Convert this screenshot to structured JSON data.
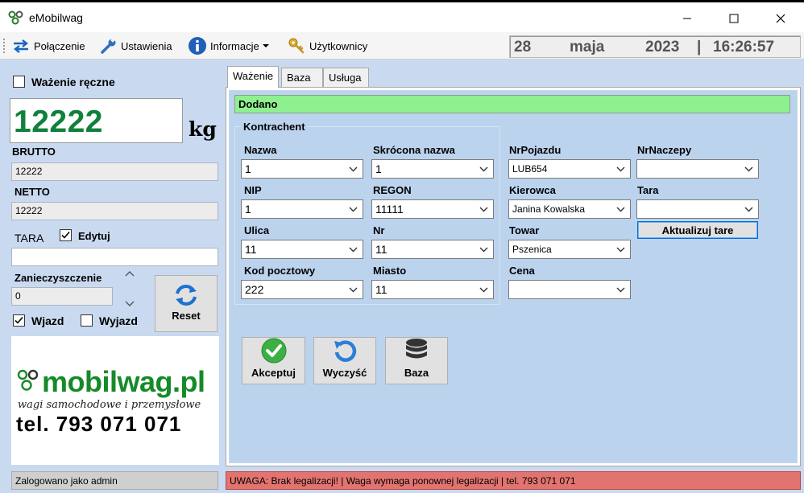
{
  "window": {
    "title": "eMobilwag"
  },
  "menu": {
    "connection": "Połączenie",
    "settings": "Ustawienia",
    "info": "Informacje",
    "users": "Użytkownicy"
  },
  "datetime": {
    "day": "28",
    "month": "maja",
    "year": "2023",
    "separator": "|",
    "time": "16:26:57"
  },
  "left": {
    "manual_weighing_label": "Ważenie ręczne",
    "manual_weighing_checked": false,
    "weight_value": "12222",
    "weight_unit": "kg",
    "brutto_label": "BRUTTO",
    "brutto_value": "12222",
    "netto_label": "NETTO",
    "netto_value": "12222",
    "tara_label": "TARA",
    "edit_label": "Edytuj",
    "edit_checked": true,
    "tara_value": "",
    "contamination_label": "Zanieczyszczenie",
    "contamination_value": "0",
    "reset_label": "Reset",
    "entry_label": "Wjazd",
    "entry_checked": true,
    "exit_label": "Wyjazd",
    "exit_checked": false
  },
  "logo": {
    "brand": "mobilwag.pl",
    "tagline": "wagi samochodowe i przemysłowe",
    "phone": "tel. 793 071 071"
  },
  "tabs": [
    {
      "label": "Ważenie",
      "active": true
    },
    {
      "label": "Baza",
      "active": false
    },
    {
      "label": "Usługa",
      "active": false
    }
  ],
  "banner": {
    "text": "Dodano",
    "color": "#8ff08f"
  },
  "form": {
    "group_title": "Kontrachent",
    "nazwa_label": "Nazwa",
    "nazwa_value": "1",
    "skrocona_label": "Skrócona nazwa",
    "skrocona_value": "1",
    "nip_label": "NIP",
    "nip_value": "1",
    "regon_label": "REGON",
    "regon_value": "11111",
    "ulica_label": "Ulica",
    "ulica_value": "11",
    "nr_label": "Nr",
    "nr_value": "11",
    "kod_label": "Kod pocztowy",
    "kod_value": "222",
    "miasto_label": "Miasto",
    "miasto_value": "11",
    "nrpojazdu_label": "NrPojazdu",
    "nrpojazdu_value": "LUB654",
    "nrnaczepy_label": "NrNaczepy",
    "nrnaczepy_value": "",
    "kierowca_label": "Kierowca",
    "kierowca_value": "Janina Kowalska",
    "tara_label": "Tara",
    "tara_value": "",
    "towar_label": "Towar",
    "towar_value": "Pszenica",
    "cena_label": "Cena",
    "cena_value": "",
    "update_tare_label": "Aktualizuj tare"
  },
  "actions": {
    "accept": "Akceptuj",
    "clear": "Wyczyść",
    "database": "Baza"
  },
  "status": {
    "logged_in": "Zalogowano jako admin",
    "warning": "UWAGA: Brak legalizacji!  |  Waga wymaga ponownej legalizacji  |  tel. 793 071 071",
    "warning_color": "#e27470"
  }
}
